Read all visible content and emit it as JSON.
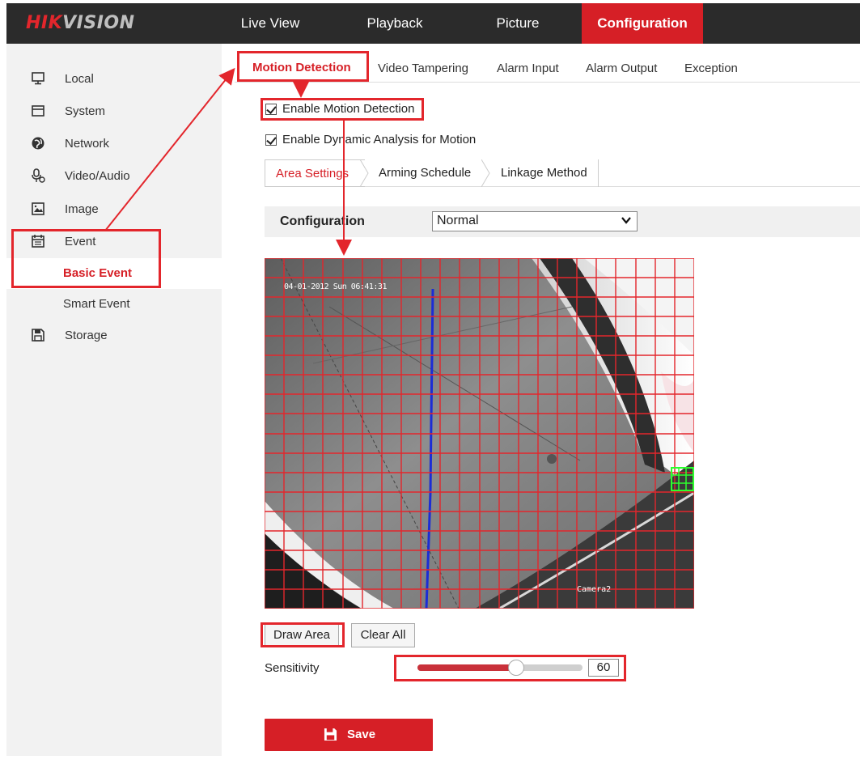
{
  "header": {
    "brand_main": "HIK",
    "brand_rest": "VISION",
    "nav": [
      "Live View",
      "Playback",
      "Picture",
      "Configuration"
    ],
    "active_nav": "Configuration"
  },
  "sidebar": {
    "items": [
      {
        "label": "Local",
        "icon": "monitor-icon"
      },
      {
        "label": "System",
        "icon": "window-icon"
      },
      {
        "label": "Network",
        "icon": "globe-icon"
      },
      {
        "label": "Video/Audio",
        "icon": "microphone-icon"
      },
      {
        "label": "Image",
        "icon": "image-icon"
      },
      {
        "label": "Event",
        "icon": "calendar-icon"
      }
    ],
    "sub_items": [
      "Basic Event",
      "Smart Event"
    ],
    "active_sub": "Basic Event",
    "storage_label": "Storage"
  },
  "tabs": [
    "Motion Detection",
    "Video Tampering",
    "Alarm Input",
    "Alarm Output",
    "Exception"
  ],
  "active_tab": "Motion Detection",
  "checkboxes": {
    "enable_motion": {
      "label": "Enable Motion Detection",
      "checked": true
    },
    "enable_dynamic": {
      "label": "Enable Dynamic Analysis for Motion",
      "checked": true
    }
  },
  "steps": [
    "Area Settings",
    "Arming Schedule",
    "Linkage Method"
  ],
  "active_step": "Area Settings",
  "config": {
    "label": "Configuration",
    "value": "Normal"
  },
  "video": {
    "osd_timestamp": "04-01-2012 Sun 06:41:31",
    "osd_camera_name": "Camera2"
  },
  "actions": {
    "draw_area": "Draw Area",
    "clear_all": "Clear All"
  },
  "sensitivity": {
    "label": "Sensitivity",
    "value": 60,
    "max": 100
  },
  "save_label": "Save",
  "colors": {
    "accent": "#d61f26",
    "annotation": "#e3262c",
    "topbar": "#2b2b2b",
    "sidebar": "#f2f2f2"
  }
}
